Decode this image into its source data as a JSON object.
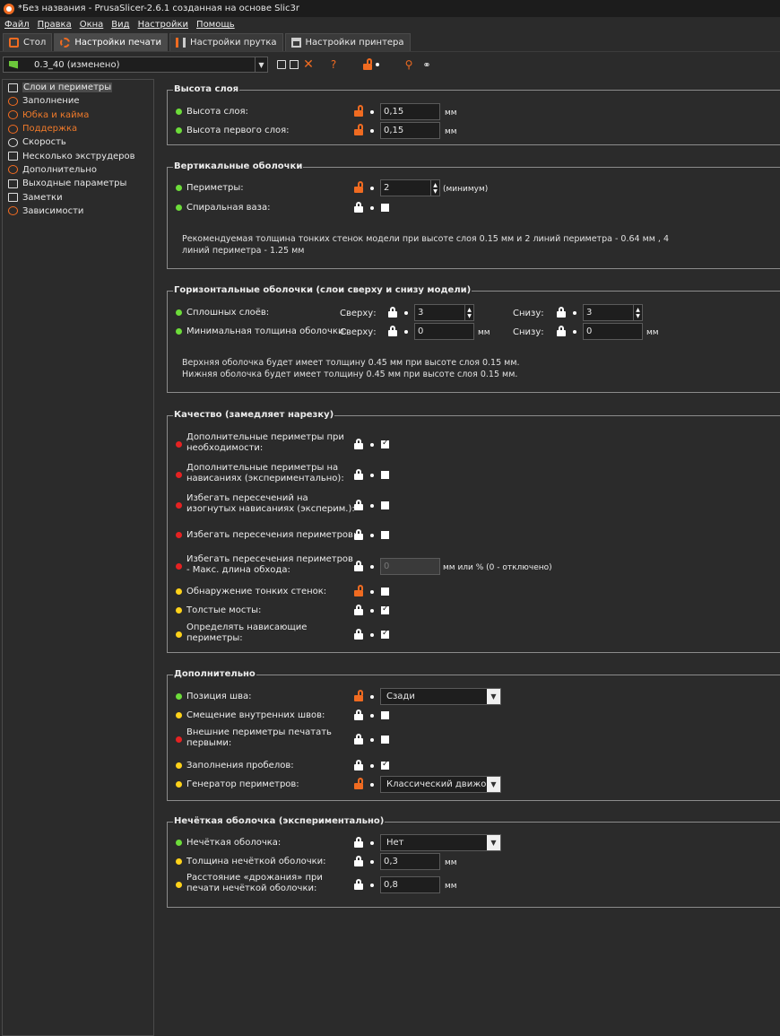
{
  "window": {
    "title": "*Без названия - PrusaSlicer-2.6.1 созданная на основе Slic3r"
  },
  "menu": [
    "Файл",
    "Правка",
    "Окна",
    "Вид",
    "Настройки",
    "Помощь"
  ],
  "tabs": [
    "Стол",
    "Настройки печати",
    "Настройки прутка",
    "Настройки принтера"
  ],
  "preset": {
    "value": "0.3_40 (изменено)"
  },
  "sidebar": [
    {
      "label": "Слои и периметры",
      "icon": "layers-icon"
    },
    {
      "label": "Заполнение",
      "icon": "infill-icon"
    },
    {
      "label": "Юбка и кайма",
      "icon": "skirt-icon"
    },
    {
      "label": "Поддержка",
      "icon": "support-icon"
    },
    {
      "label": "Скорость",
      "icon": "speed-icon"
    },
    {
      "label": "Несколько экструдеров",
      "icon": "extruder-icon"
    },
    {
      "label": "Дополнительно",
      "icon": "wrench-icon"
    },
    {
      "label": "Выходные параметры",
      "icon": "output-icon"
    },
    {
      "label": "Заметки",
      "icon": "notes-icon"
    },
    {
      "label": "Зависимости",
      "icon": "dependencies-icon"
    }
  ],
  "groups": {
    "layer_height": {
      "title": "Высота слоя",
      "layer_height": {
        "label": "Высота слоя:",
        "value": "0,15",
        "unit": "мм"
      },
      "first_layer": {
        "label": "Высота первого слоя:",
        "value": "0,15",
        "unit": "мм"
      }
    },
    "vertical_shells": {
      "title": "Вертикальные оболочки",
      "perimeters": {
        "label": "Периметры:",
        "value": "2",
        "unit": "(минимум)"
      },
      "spiral": {
        "label": "Спиральная ваза:"
      },
      "note_line1": "Рекомендуемая толщина тонких стенок модели при высоте слоя 0.15 мм и 2 линий периметра - 0.64 мм , 4",
      "note_line2": "линий периметра - 1.25 мм"
    },
    "horizontal_shells": {
      "title": "Горизонтальные оболочки (слои сверху и снизу модели)",
      "solid_layers": {
        "label": "Сплошных слоёв:",
        "top_label": "Сверху:",
        "top_value": "3",
        "bottom_label": "Снизу:",
        "bottom_value": "3"
      },
      "min_thickness": {
        "label": "Минимальная толщина оболочки:",
        "top_label": "Сверху:",
        "top_value": "0",
        "bottom_label": "Снизу:",
        "bottom_value": "0",
        "unit": "мм"
      },
      "note_line1": "Верхняя оболочка будет имеет толщину 0.45 мм при высоте слоя 0.15 мм.",
      "note_line2": "Нижняя оболочка будет имеет толщину 0.45 мм при высоте слоя 0.15 мм."
    },
    "quality": {
      "title": "Качество (замедляет нарезку)",
      "extra_perimeters_line1": "Дополнительные периметры при",
      "extra_perimeters_line2": "необходимости:",
      "overhang_perimeters_line1": "Дополнительные периметры на",
      "overhang_perimeters_line2": "нависаниях (экспериментально):",
      "avoid_curled_line1": "Избегать пересечений на",
      "avoid_curled_line2": "изогнутых нависаниях (эксперим.):",
      "avoid_crossing": "Избегать пересечения периметров:",
      "max_detour_line1": "Избегать пересечения периметров",
      "max_detour_line2": "- Макс. длина обхода:",
      "max_detour_value": "0",
      "max_detour_unit": "мм или % (0 - отключено)",
      "thin_walls": "Обнаружение тонких стенок:",
      "thick_bridges": "Толстые мосты:",
      "detect_overhang_line1": "Определять нависающие",
      "detect_overhang_line2": "периметры:"
    },
    "advanced": {
      "title": "Дополнительно",
      "seam_position": {
        "label": "Позиция шва:",
        "value": "Сзади"
      },
      "staggered_seams": "Смещение внутренних швов:",
      "external_first_line1": "Внешние периметры печатать",
      "external_first_line2": "первыми:",
      "gap_fill": "Заполнения пробелов:",
      "perimeter_generator": {
        "label": "Генератор периметров:",
        "value": "Классический движок"
      }
    },
    "fuzzy_skin": {
      "title": "Нечёткая оболочка (экспериментально)",
      "fuzzy": {
        "label": "Нечёткая оболочка:",
        "value": "Нет"
      },
      "thickness": {
        "label": "Толщина нечёткой оболочки:",
        "value": "0,3",
        "unit": "мм"
      },
      "point_dist_line1": "Расстояние «дрожания» при",
      "point_dist_line2": "печати нечёткой оболочки:",
      "point_dist_value": "0,8",
      "point_dist_unit": "мм"
    }
  }
}
